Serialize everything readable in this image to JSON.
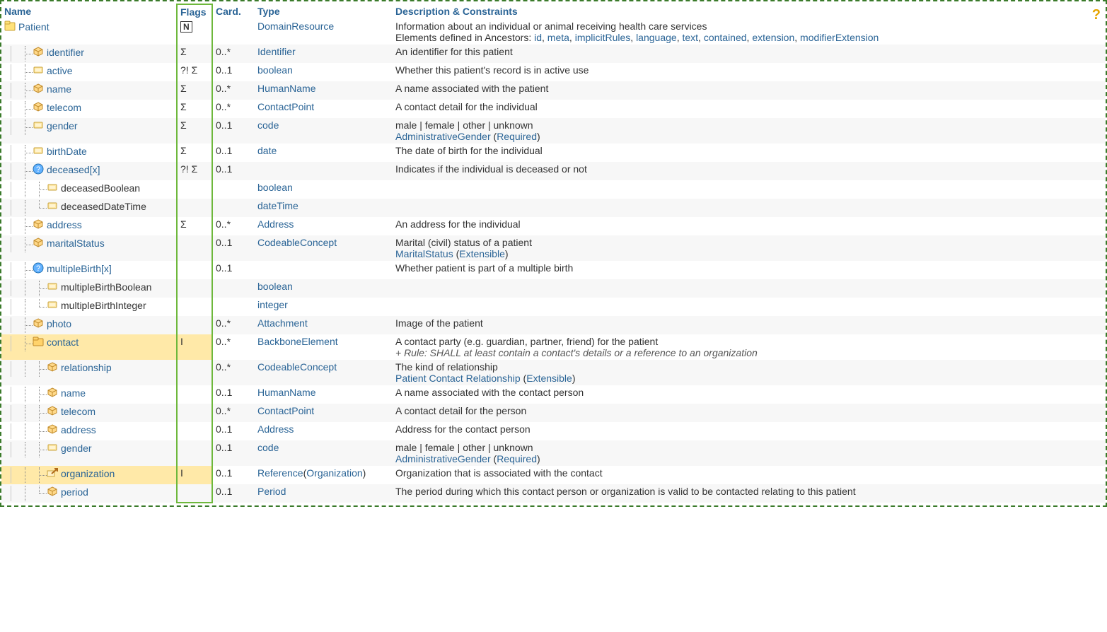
{
  "headers": {
    "name": "Name",
    "flags": "Flags",
    "card": "Card.",
    "type": "Type",
    "desc": "Description & Constraints"
  },
  "help_title": "Help",
  "ancestors_prefix": "Elements defined in Ancestors: ",
  "ancestors": [
    "id",
    "meta",
    "implicitRules",
    "language",
    "text",
    "contained",
    "extension",
    "modifierExtension"
  ],
  "flag_n": "N",
  "rows": [
    {
      "depth": 0,
      "join": "",
      "icon": "resource",
      "name": "Patient",
      "link": true,
      "flags_n": true,
      "card": "",
      "type": [
        {
          "t": "DomainResource",
          "l": true
        }
      ],
      "desc": "Information about an individual or animal receiving health care services",
      "show_ancestors": true
    },
    {
      "depth": 1,
      "join": "t",
      "icon": "complex",
      "name": "identifier",
      "link": true,
      "flags": "Σ",
      "card": "0..*",
      "type": [
        {
          "t": "Identifier",
          "l": true
        }
      ],
      "desc": "An identifier for this patient"
    },
    {
      "depth": 1,
      "join": "t",
      "icon": "prim",
      "name": "active",
      "link": true,
      "flags": "?! Σ",
      "card": "0..1",
      "type": [
        {
          "t": "boolean",
          "l": true
        }
      ],
      "desc": "Whether this patient's record is in active use"
    },
    {
      "depth": 1,
      "join": "t",
      "icon": "complex",
      "name": "name",
      "link": true,
      "flags": "Σ",
      "card": "0..*",
      "type": [
        {
          "t": "HumanName",
          "l": true
        }
      ],
      "desc": "A name associated with the patient"
    },
    {
      "depth": 1,
      "join": "t",
      "icon": "complex",
      "name": "telecom",
      "link": true,
      "flags": "Σ",
      "card": "0..*",
      "type": [
        {
          "t": "ContactPoint",
          "l": true
        }
      ],
      "desc": "A contact detail for the individual"
    },
    {
      "depth": 1,
      "join": "t",
      "icon": "prim",
      "name": "gender",
      "link": true,
      "flags": "Σ",
      "card": "0..1",
      "type": [
        {
          "t": "code",
          "l": true
        }
      ],
      "desc": "male | female | other | unknown",
      "binding": {
        "vs": "AdministrativeGender",
        "strength": "Required"
      }
    },
    {
      "depth": 1,
      "join": "t",
      "icon": "prim",
      "name": "birthDate",
      "link": true,
      "flags": "Σ",
      "card": "0..1",
      "type": [
        {
          "t": "date",
          "l": true
        }
      ],
      "desc": "The date of birth for the individual"
    },
    {
      "depth": 1,
      "join": "t",
      "cont": true,
      "icon": "choice",
      "name": "deceased[x]",
      "link": true,
      "flags": "?! Σ",
      "card": "0..1",
      "type": [],
      "desc": "Indicates if the individual is deceased or not"
    },
    {
      "depth": 2,
      "join": "t",
      "icon": "prim",
      "name": "deceasedBoolean",
      "link": false,
      "card": "",
      "type": [
        {
          "t": "boolean",
          "l": true
        }
      ],
      "desc": ""
    },
    {
      "depth": 2,
      "join": "l",
      "icon": "prim",
      "name": "deceasedDateTime",
      "link": false,
      "card": "",
      "type": [
        {
          "t": "dateTime",
          "l": true
        }
      ],
      "desc": ""
    },
    {
      "depth": 1,
      "join": "t",
      "icon": "complex",
      "name": "address",
      "link": true,
      "flags": "Σ",
      "card": "0..*",
      "type": [
        {
          "t": "Address",
          "l": true
        }
      ],
      "desc": "An address for the individual"
    },
    {
      "depth": 1,
      "join": "t",
      "icon": "complex",
      "name": "maritalStatus",
      "link": true,
      "card": "0..1",
      "type": [
        {
          "t": "CodeableConcept",
          "l": true
        }
      ],
      "desc": "Marital (civil) status of a patient",
      "binding": {
        "vs": "MaritalStatus",
        "strength": "Extensible"
      }
    },
    {
      "depth": 1,
      "join": "t",
      "cont": true,
      "icon": "choice",
      "name": "multipleBirth[x]",
      "link": true,
      "card": "0..1",
      "type": [],
      "desc": "Whether patient is part of a multiple birth"
    },
    {
      "depth": 2,
      "join": "t",
      "icon": "prim",
      "name": "multipleBirthBoolean",
      "link": false,
      "card": "",
      "type": [
        {
          "t": "boolean",
          "l": true
        }
      ],
      "desc": ""
    },
    {
      "depth": 2,
      "join": "l",
      "icon": "prim",
      "name": "multipleBirthInteger",
      "link": false,
      "card": "",
      "type": [
        {
          "t": "integer",
          "l": true
        }
      ],
      "desc": ""
    },
    {
      "depth": 1,
      "join": "t",
      "icon": "complex",
      "name": "photo",
      "link": true,
      "card": "0..*",
      "type": [
        {
          "t": "Attachment",
          "l": true
        }
      ],
      "desc": "Image of the patient"
    },
    {
      "depth": 1,
      "join": "t",
      "cont": true,
      "icon": "folder",
      "name": "contact",
      "link": true,
      "flags": "I",
      "card": "0..*",
      "type": [
        {
          "t": "BackboneElement",
          "l": true
        }
      ],
      "desc": "A contact party (e.g. guardian, partner, friend) for the patient",
      "rule": "+ Rule: SHALL at least contain a contact's details or a reference to an organization",
      "hl": true
    },
    {
      "depth": 2,
      "join": "t",
      "icon": "complex",
      "name": "relationship",
      "link": true,
      "card": "0..*",
      "type": [
        {
          "t": "CodeableConcept",
          "l": true
        }
      ],
      "desc": "The kind of relationship",
      "binding": {
        "vs": "Patient Contact Relationship",
        "strength": "Extensible"
      }
    },
    {
      "depth": 2,
      "join": "t",
      "icon": "complex",
      "name": "name",
      "link": true,
      "card": "0..1",
      "type": [
        {
          "t": "HumanName",
          "l": true
        }
      ],
      "desc": "A name associated with the contact person"
    },
    {
      "depth": 2,
      "join": "t",
      "icon": "complex",
      "name": "telecom",
      "link": true,
      "card": "0..*",
      "type": [
        {
          "t": "ContactPoint",
          "l": true
        }
      ],
      "desc": "A contact detail for the person"
    },
    {
      "depth": 2,
      "join": "t",
      "icon": "complex",
      "name": "address",
      "link": true,
      "card": "0..1",
      "type": [
        {
          "t": "Address",
          "l": true
        }
      ],
      "desc": "Address for the contact person"
    },
    {
      "depth": 2,
      "join": "t",
      "icon": "prim",
      "name": "gender",
      "link": true,
      "card": "0..1",
      "type": [
        {
          "t": "code",
          "l": true
        }
      ],
      "desc": "male | female | other | unknown",
      "binding": {
        "vs": "AdministrativeGender",
        "strength": "Required"
      }
    },
    {
      "depth": 2,
      "join": "t",
      "icon": "ref",
      "name": "organization",
      "link": true,
      "flags": "I",
      "card": "0..1",
      "type": [
        {
          "t": "Reference",
          "l": true
        },
        {
          "t": "(",
          "l": false
        },
        {
          "t": "Organization",
          "l": true
        },
        {
          "t": ")",
          "l": false
        }
      ],
      "desc": "Organization that is associated with the contact",
      "hl": true
    },
    {
      "depth": 2,
      "join": "l",
      "icon": "complex",
      "name": "period",
      "link": true,
      "card": "0..1",
      "type": [
        {
          "t": "Period",
          "l": true
        }
      ],
      "desc": "The period during which this contact person or organization is valid to be contacted relating to this patient"
    }
  ]
}
